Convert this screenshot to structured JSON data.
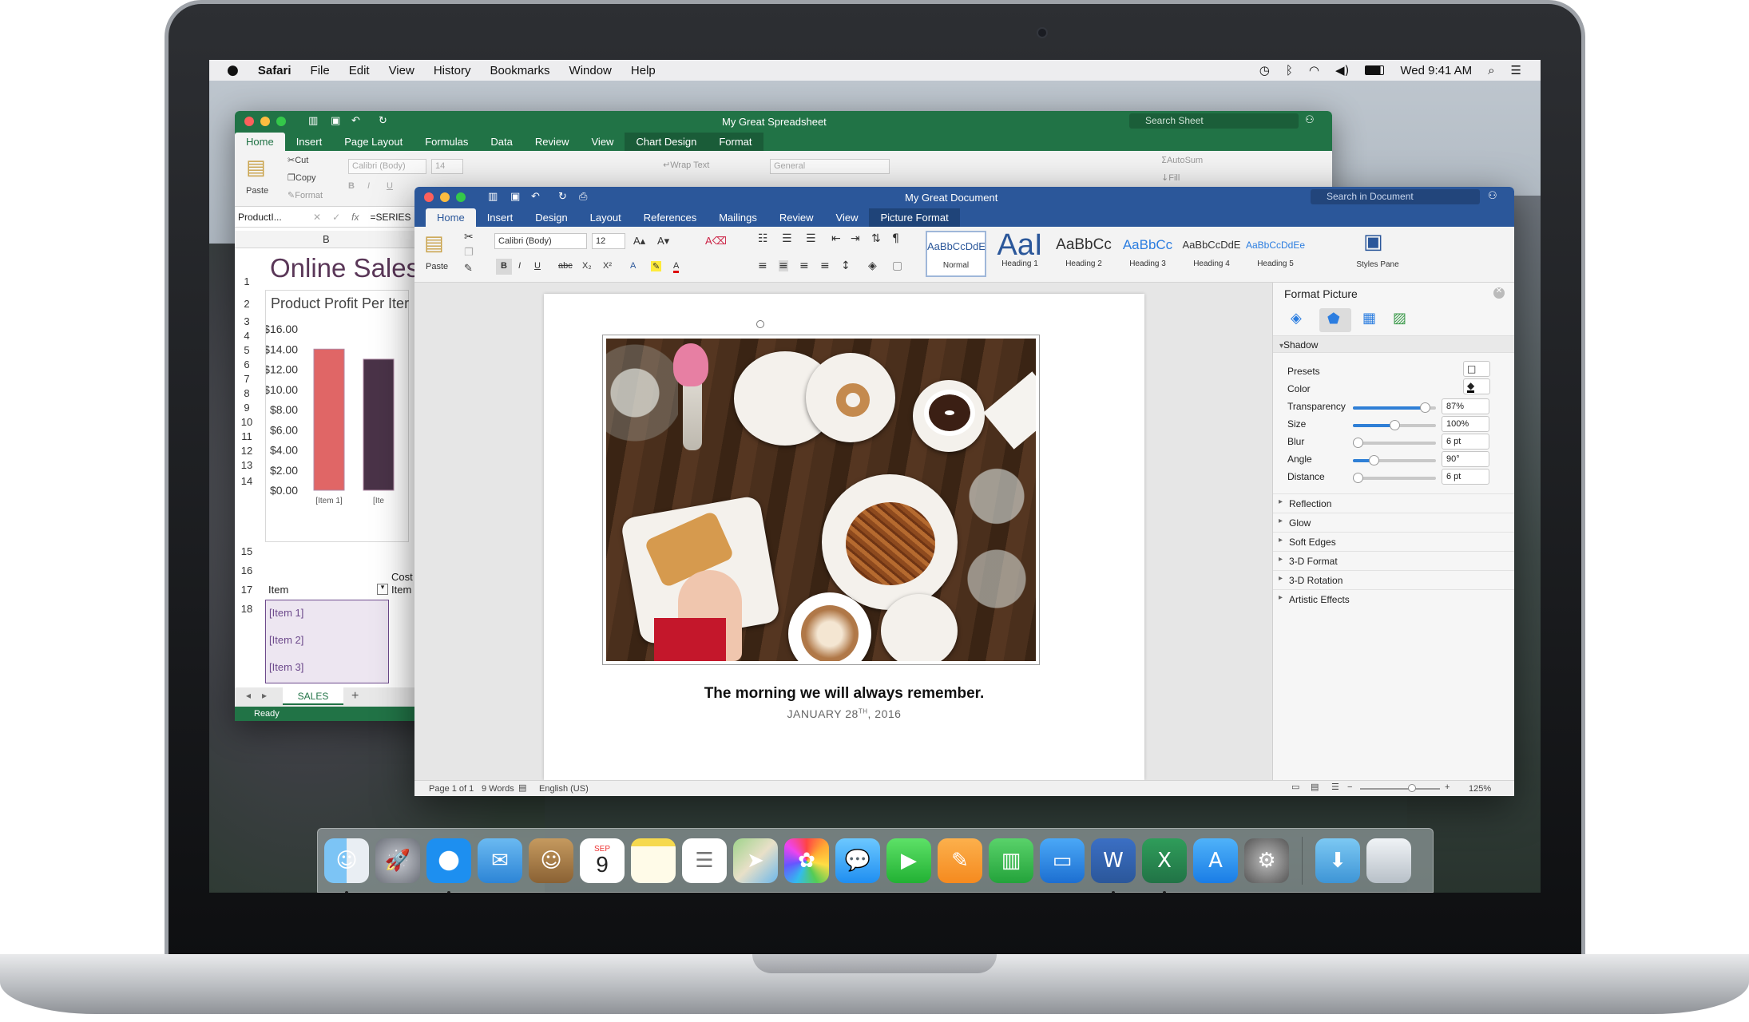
{
  "menubar": {
    "apple": "",
    "items": [
      "Safari",
      "File",
      "Edit",
      "View",
      "History",
      "Bookmarks",
      "Window",
      "Help"
    ],
    "clock": "Wed 9:41 AM"
  },
  "excel": {
    "title": "My Great Spreadsheet",
    "search_placeholder": "Search Sheet",
    "tabs": [
      "Home",
      "Insert",
      "Page Layout",
      "Formulas",
      "Data",
      "Review",
      "View",
      "Chart Design",
      "Format"
    ],
    "ribbon": {
      "paste": "Paste",
      "cut": "Cut",
      "copy": "Copy",
      "format": "Format",
      "font": "Calibri (Body)",
      "size": "14",
      "wrap": "Wrap Text",
      "number_format": "General",
      "autosum": "AutoSum",
      "fill": "Fill"
    },
    "name_box": "ProductI...",
    "formula": "=SERIES",
    "col_b": "B",
    "heading": "Online Sales",
    "chart_title": "Product Profit Per Iter",
    "table_header_item": "Item",
    "table_header_cost": "Cost I",
    "table_header_cost2": "Item",
    "items": [
      "[Item 1]",
      "[Item 2]",
      "[Item 3]"
    ],
    "row_numbers": [
      "1",
      "2",
      "3",
      "4",
      "5",
      "6",
      "7",
      "8",
      "9",
      "10",
      "11",
      "12",
      "13",
      "14",
      "15",
      "16",
      "17",
      "18"
    ],
    "sheet_tab": "SALES",
    "status": "Ready"
  },
  "chart_data": {
    "type": "bar",
    "title": "Product Profit Per Iter",
    "categories": [
      "[Item 1]",
      "[Ite"
    ],
    "values": [
      14,
      13
    ],
    "ylim": [
      0,
      16
    ],
    "yticks": [
      "$16.00",
      "$14.00",
      "$12.00",
      "$10.00",
      "$8.00",
      "$6.00",
      "$4.00",
      "$2.00",
      "$0.00"
    ],
    "colors": [
      "#e06666",
      "#4a3348"
    ]
  },
  "word": {
    "title": "My Great Document",
    "search_placeholder": "Search in Document",
    "tabs": [
      "Home",
      "Insert",
      "Design",
      "Layout",
      "References",
      "Mailings",
      "Review",
      "View",
      "Picture Format"
    ],
    "ribbon": {
      "paste": "Paste",
      "font": "Calibri (Body)",
      "size": "12",
      "styles_pane": "Styles Pane"
    },
    "styles": [
      {
        "sample": "AaBbCcDdEe",
        "name": "Normal"
      },
      {
        "sample": "AaI",
        "name": "Heading 1"
      },
      {
        "sample": "AaBbCc",
        "name": "Heading 2"
      },
      {
        "sample": "AaBbCc",
        "name": "Heading 3"
      },
      {
        "sample": "AaBbCcDdE",
        "name": "Heading 4"
      },
      {
        "sample": "AaBbCcDdEe",
        "name": "Heading 5"
      }
    ],
    "caption": "The morning we will always remember.",
    "date_main": "JANUARY 28",
    "date_sup": "TH",
    "date_year": ", 2016",
    "status": {
      "page": "Page 1 of 1",
      "words": "9 Words",
      "lang": "English (US)",
      "zoom": "125%"
    },
    "pane": {
      "title": "Format Picture",
      "shadow": "Shadow",
      "presets": "Presets",
      "color": "Color",
      "rows": [
        {
          "label": "Transparency",
          "value": "87%",
          "level": 0.87
        },
        {
          "label": "Size",
          "value": "100%",
          "level": 0.5
        },
        {
          "label": "Blur",
          "value": "6 pt",
          "level": 0.06
        },
        {
          "label": "Angle",
          "value": "90°",
          "level": 0.25
        },
        {
          "label": "Distance",
          "value": "6 pt",
          "level": 0.06
        }
      ],
      "sections": [
        "Reflection",
        "Glow",
        "Soft Edges",
        "3-D Format",
        "3-D Rotation",
        "Artistic Effects"
      ]
    }
  },
  "dock": {
    "calendar_month": "SEP",
    "calendar_day": "9",
    "apps": [
      "finder-icon",
      "launchpad-icon",
      "safari-icon",
      "mail-icon",
      "contacts-icon",
      "calendar-icon",
      "notes-icon",
      "reminders-icon",
      "maps-icon",
      "photos-icon",
      "messages-icon",
      "facetime-icon",
      "pages-icon",
      "numbers-icon",
      "keynote-icon",
      "word-icon",
      "excel-icon",
      "appstore-icon",
      "system-preferences-icon",
      "downloads-icon",
      "trash-icon"
    ]
  }
}
